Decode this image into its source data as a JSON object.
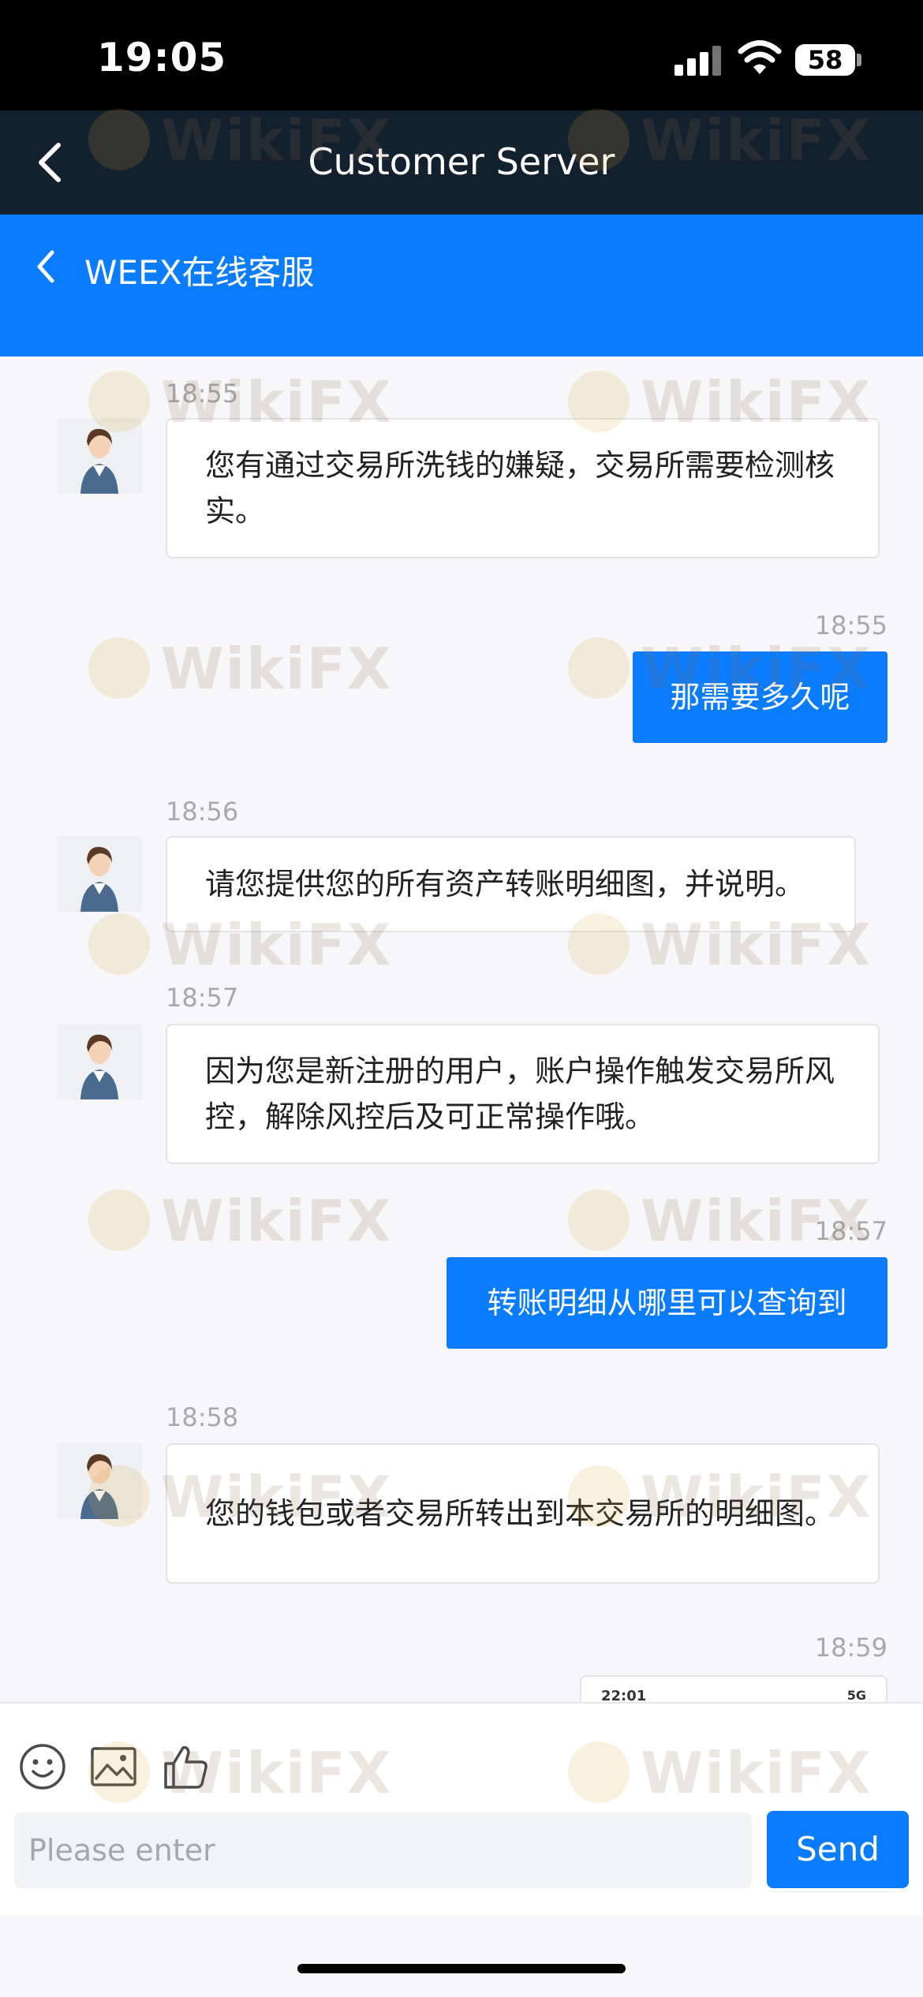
{
  "status_bar": {
    "time": "19:05",
    "battery": "58"
  },
  "nav": {
    "title": "Customer Server"
  },
  "sub_header": {
    "title": "WEEX在线客服"
  },
  "messages": [
    {
      "side": "agent",
      "time": "18:55",
      "text": "您有通过交易所洗钱的嫌疑，交易所需要检测核实。"
    },
    {
      "side": "user",
      "time": "18:55",
      "text": "那需要多久呢"
    },
    {
      "side": "agent",
      "time": "18:56",
      "text": "请您提供您的所有资产转账明细图，并说明。"
    },
    {
      "side": "agent",
      "time": "18:57",
      "text": "因为您是新注册的用户，账户操作触发交易所风控，解除风控后及可正常操作哦。"
    },
    {
      "side": "user",
      "time": "18:57",
      "text": "转账明细从哪里可以查询到"
    },
    {
      "side": "agent",
      "time": "18:58",
      "text": "您的钱包或者交易所转出到本交易所的明细图。"
    },
    {
      "side": "user",
      "time": "18:59",
      "image_time": "22:01",
      "image_network": "5G"
    }
  ],
  "composer": {
    "placeholder": "Please enter",
    "send_label": "Send"
  },
  "watermark": "WikiFX",
  "colors": {
    "accent": "#0a7cff",
    "nav_bg": "#13202e"
  }
}
